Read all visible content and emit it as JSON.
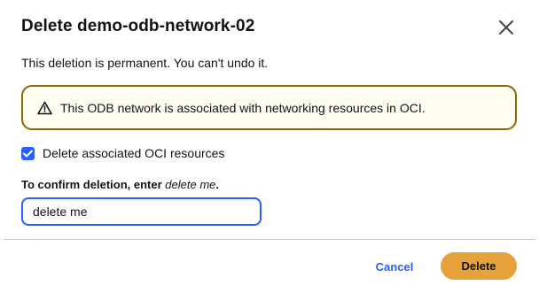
{
  "modal": {
    "title": "Delete demo-odb-network-02",
    "close_icon": "close-icon",
    "description": "This deletion is permanent. You can't undo it."
  },
  "alert": {
    "icon": "warning-icon",
    "text": "This ODB network is associated with networking resources in OCI.",
    "border_color": "#8d6605",
    "background_color": "#fffef0"
  },
  "checkbox": {
    "label": "Delete associated OCI resources",
    "checked": true
  },
  "confirm": {
    "label_prefix": "To confirm deletion, enter ",
    "label_phrase": "delete me",
    "label_suffix": ".",
    "value": "delete me"
  },
  "footer": {
    "cancel_label": "Cancel",
    "delete_label": "Delete"
  },
  "colors": {
    "accent": "#295eff",
    "delete_button": "#e6a13a",
    "text": "#0f141a"
  }
}
